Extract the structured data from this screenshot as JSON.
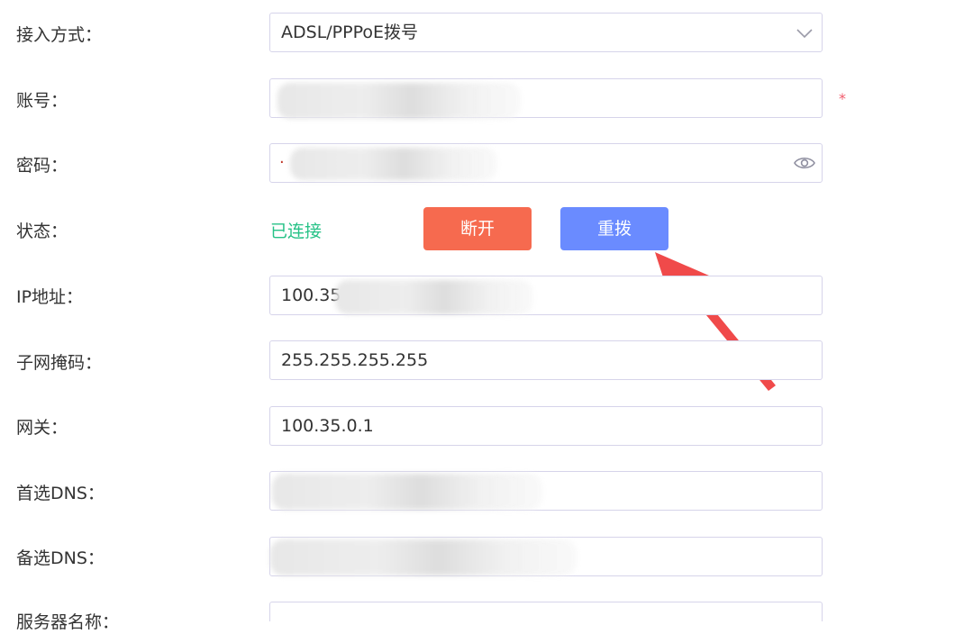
{
  "form": {
    "access_method": {
      "label": "接入方式：",
      "value": "ADSL/PPPoE拨号"
    },
    "account": {
      "label": "账号：",
      "required_mark": "*"
    },
    "password": {
      "label": "密码：",
      "visible_char": "·"
    },
    "status": {
      "label": "状态：",
      "value": "已连接",
      "disconnect_label": "断开",
      "redial_label": "重拨"
    },
    "ip": {
      "label": "IP地址：",
      "value": "100.35"
    },
    "subnet": {
      "label": "子网掩码：",
      "value": "255.255.255.255"
    },
    "gateway": {
      "label": "网关：",
      "value": "100.35.0.1"
    },
    "dns1": {
      "label": "首选DNS："
    },
    "dns2": {
      "label": "备选DNS："
    },
    "server_name": {
      "label": "服务器名称："
    }
  },
  "colors": {
    "connected_green": "#27c287",
    "disconnect_red": "#f66a4f",
    "redial_blue": "#6a8bff",
    "annotation_arrow": "#f04a4a",
    "required_red": "#f15b6c"
  },
  "icons": {
    "dropdown": "chevron-down-icon",
    "password_toggle": "eye-icon",
    "annotation": "arrow-icon"
  }
}
